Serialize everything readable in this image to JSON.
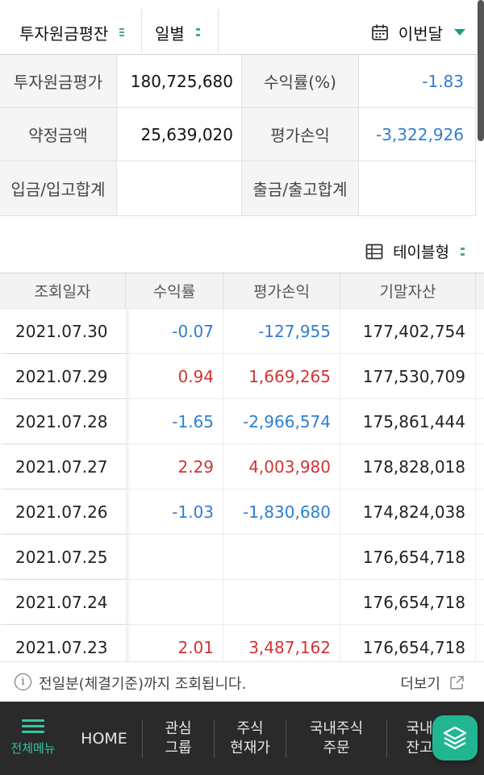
{
  "filters": {
    "account_type": "투자원금평잔",
    "period_type": "일별",
    "period": "이번달"
  },
  "summary": {
    "rows": [
      {
        "label1": "투자원금평가",
        "value1": "180,725,680",
        "label2": "수익률(%)",
        "value2": "-1.83"
      },
      {
        "label1": "약정금액",
        "value1": "25,639,020",
        "label2": "평가손익",
        "value2": "-3,322,926"
      },
      {
        "label1": "입금/입고합계",
        "value1": "",
        "label2": "출금/출고합계",
        "value2": ""
      }
    ]
  },
  "view_toggle": {
    "label": "테이블형"
  },
  "table": {
    "headers": [
      "조회일자",
      "수익률",
      "평가손익",
      "기말자산"
    ],
    "rows": [
      {
        "date": "2021.07.30",
        "rate": "-0.07",
        "pl": "-127,955",
        "end": "177,402,754",
        "sign": "neg"
      },
      {
        "date": "2021.07.29",
        "rate": "0.94",
        "pl": "1,669,265",
        "end": "177,530,709",
        "sign": "pos"
      },
      {
        "date": "2021.07.28",
        "rate": "-1.65",
        "pl": "-2,966,574",
        "end": "175,861,444",
        "sign": "neg"
      },
      {
        "date": "2021.07.27",
        "rate": "2.29",
        "pl": "4,003,980",
        "end": "178,828,018",
        "sign": "pos"
      },
      {
        "date": "2021.07.26",
        "rate": "-1.03",
        "pl": "-1,830,680",
        "end": "174,824,038",
        "sign": "neg"
      },
      {
        "date": "2021.07.25",
        "rate": "",
        "pl": "",
        "end": "176,654,718",
        "sign": "none"
      },
      {
        "date": "2021.07.24",
        "rate": "",
        "pl": "",
        "end": "176,654,718",
        "sign": "none"
      },
      {
        "date": "2021.07.23",
        "rate": "2.01",
        "pl": "3,487,162",
        "end": "176,654,718",
        "sign": "pos"
      }
    ]
  },
  "notice": {
    "text": "전일분(체결기준)까지 조회됩니다.",
    "more_label": "더보기"
  },
  "bottom_nav": {
    "menu_label": "전체메뉴",
    "home_label": "HOME",
    "items": [
      "관심\n그룹",
      "주식\n현재가",
      "국내주식\n주문",
      "국내\n잔고"
    ]
  },
  "colors": {
    "positive": "#d33333",
    "negative": "#2f7fcf",
    "accent": "#35c7a2",
    "nav_bg": "#2a2a2a"
  },
  "icons": [
    "calendar-icon",
    "grid-table-icon",
    "info-icon",
    "external-link-icon",
    "hamburger-menu-icon",
    "layers-icon"
  ]
}
